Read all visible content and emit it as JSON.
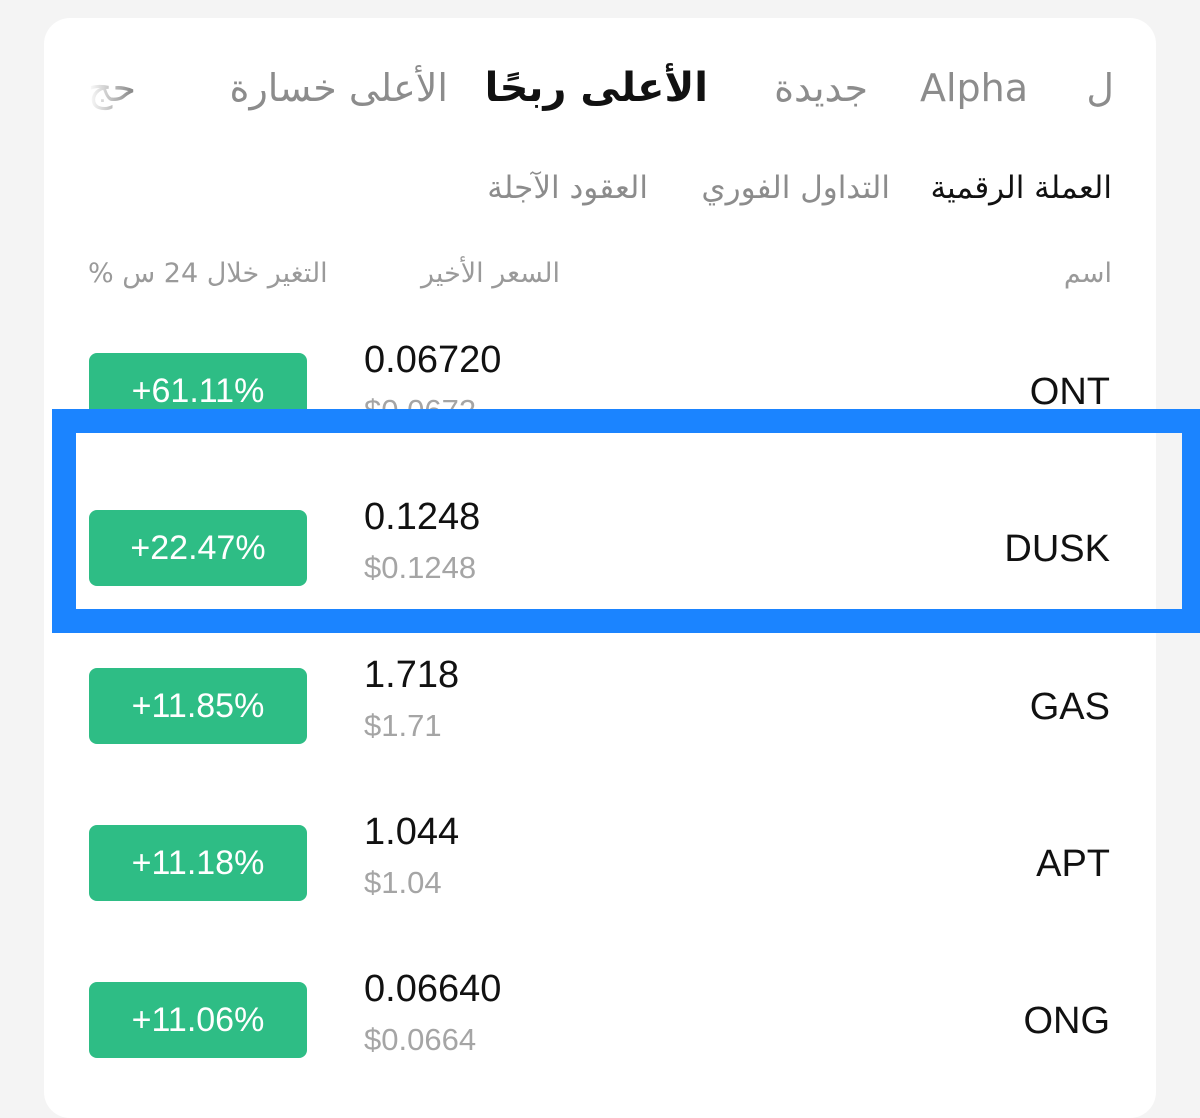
{
  "tabs": {
    "partial_right": "ل",
    "alpha": "Alpha",
    "new": "جديدة",
    "top_gainers": "الأعلى ربحًا",
    "top_losers": "الأعلى خسارة",
    "partial_left": "حج"
  },
  "sub_tabs": {
    "crypto": "العملة الرقمية",
    "spot": "التداول الفوري",
    "futures": "العقود الآجلة"
  },
  "columns": {
    "name": "اسم",
    "last_price": "السعر الأخير",
    "change_24h": "% التغير خلال 24 س"
  },
  "rows": [
    {
      "name": "ONT",
      "price": "0.06720",
      "usd": "$0.0672",
      "change": "+61.11%"
    },
    {
      "name": "DUSK",
      "price": "0.1248",
      "usd": "$0.1248",
      "change": "+22.47%"
    },
    {
      "name": "GAS",
      "price": "1.718",
      "usd": "$1.71",
      "change": "+11.85%"
    },
    {
      "name": "APT",
      "price": "1.044",
      "usd": "$1.04",
      "change": "+11.18%"
    },
    {
      "name": "ONG",
      "price": "0.06640",
      "usd": "$0.0664",
      "change": "+11.06%"
    }
  ],
  "colors": {
    "positive": "#2ebd85",
    "highlight": "#1b84ff"
  }
}
